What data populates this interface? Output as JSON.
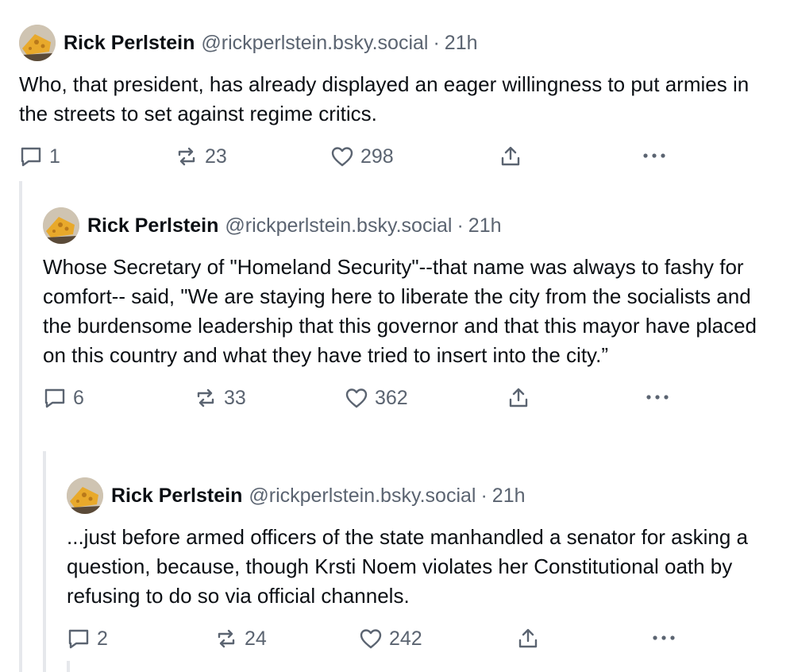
{
  "posts": [
    {
      "author": "Rick Perlstein",
      "handle": "@rickperlstein.bsky.social",
      "separator": "·",
      "time": "21h",
      "text": "Who, that president, has already displayed an eager willingness to put armies in the streets to set against regime critics.",
      "replies": "1",
      "reposts": "23",
      "likes": "298"
    },
    {
      "author": "Rick Perlstein",
      "handle": "@rickperlstein.bsky.social",
      "separator": "·",
      "time": "21h",
      "text": "Whose Secretary of \"Homeland Security\"--that name was always to fashy for comfort-- said, \"We are staying here to liberate the city from the socialists and the burdensome leadership that this governor and that this mayor have placed on this country and what they have tried to insert into the city.”",
      "replies": "6",
      "reposts": "33",
      "likes": "362"
    },
    {
      "author": "Rick Perlstein",
      "handle": "@rickperlstein.bsky.social",
      "separator": "·",
      "time": "21h",
      "text": "...just before armed officers of the state manhandled a senator for asking a question, because, though Krsti Noem violates her Constitutional oath by refusing to do so via official channels.",
      "replies": "2",
      "reposts": "24",
      "likes": "242"
    }
  ],
  "colors": {
    "text": "#0b0f14",
    "muted": "#5b6471",
    "thread_rail": "#e6e8ec"
  },
  "icons": [
    "reply-icon",
    "repost-icon",
    "like-icon",
    "share-icon",
    "more-icon"
  ]
}
